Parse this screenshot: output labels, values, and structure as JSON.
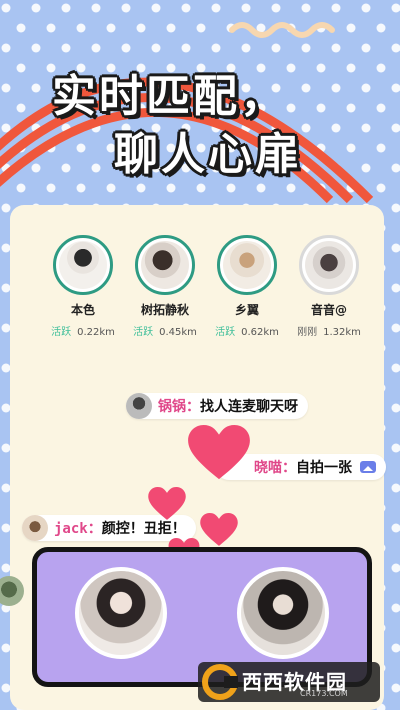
{
  "headline": {
    "line1": "实时匹配，",
    "line2": "聊人心扉"
  },
  "colors": {
    "bg": "#a9c4f2",
    "stripe": "#f0573c",
    "card": "#fbf5e2",
    "accent_green": "#2e9b83",
    "status_green": "#3fbf9a",
    "name_pink": "#e0488a",
    "heart": "#f14a73",
    "match_purple": "#b8a3ef"
  },
  "users": [
    {
      "name": "本色",
      "status": "活跃",
      "distance": "0.22km"
    },
    {
      "name": "树拓静秋",
      "status": "活跃",
      "distance": "0.45km"
    },
    {
      "name": "乡翼",
      "status": "活跃",
      "distance": "0.62km"
    },
    {
      "name": "音音@",
      "status": "刚刚",
      "distance": "1.32km"
    }
  ],
  "chats": [
    {
      "name": "锅锅：",
      "message": "找人连麦聊天呀"
    },
    {
      "name": "晓喵：",
      "message": "自拍一张"
    },
    {
      "name": "jack：",
      "message": "颜控！丑拒！"
    }
  ],
  "watermark": {
    "brand": "西西软件园",
    "domain": "CR173.COM"
  },
  "icons": [
    "photo-icon",
    "heart-icon",
    "avatar-icon"
  ]
}
